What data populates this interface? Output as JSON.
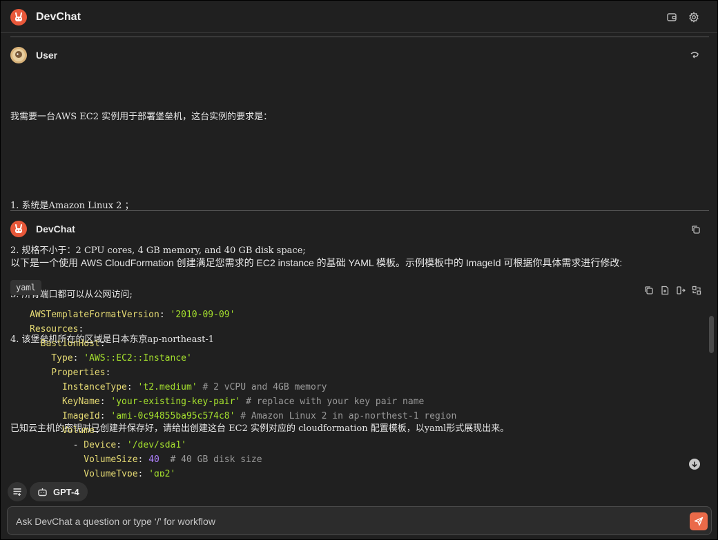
{
  "app": {
    "title": "DevChat"
  },
  "colors": {
    "accent": "#e8583a",
    "send": "#ea6a49",
    "background": "#202020"
  },
  "header": {
    "icons": [
      "wallet-icon",
      "gear-icon"
    ]
  },
  "user_message": {
    "sender": "User",
    "lines": [
      "我需要一台AWS EC2 实例用于部署堡垒机，这台实例的要求是：",
      "",
      "1. 系统是Amazon Linux 2 ；",
      "2. 规格不小于：2 CPU cores, 4 GB memory, and 40 GB disk space;",
      "3. 所有端口都可以从公网访问;",
      "4. 该堡垒机所在的区域是日本东京ap-northeast-1",
      "",
      "已知云主机的密钥对已创建并保存好，请给出创建这台 EC2 实例对应的 cloudformation 配置模板，以yaml形式展现出来。"
    ]
  },
  "bot_message": {
    "sender": "DevChat",
    "intro": "以下是一个使用 AWS CloudFormation 创建满足您需求的 EC2 instance 的基础 YAML 模板。示例模板中的 ImageId 可根据你具体需求进行修改:",
    "code_language": "yaml",
    "code_lines": [
      [
        {
          "t": "AWSTemplateFormatVersion",
          "c": "k"
        },
        {
          "t": ": ",
          "c": "p"
        },
        {
          "t": "'2010-09-09'",
          "c": "s"
        }
      ],
      [
        {
          "t": "Resources",
          "c": "k"
        },
        {
          "t": ":",
          "c": "p"
        }
      ],
      [
        {
          "t": "  BastionHost",
          "c": "k"
        },
        {
          "t": ":",
          "c": "p"
        }
      ],
      [
        {
          "t": "    Type",
          "c": "k"
        },
        {
          "t": ": ",
          "c": "p"
        },
        {
          "t": "'AWS::EC2::Instance'",
          "c": "s"
        }
      ],
      [
        {
          "t": "    Properties",
          "c": "k"
        },
        {
          "t": ":",
          "c": "p"
        }
      ],
      [
        {
          "t": "      InstanceType",
          "c": "k"
        },
        {
          "t": ": ",
          "c": "p"
        },
        {
          "t": "'t2.medium'",
          "c": "s"
        },
        {
          "t": " # 2 vCPU and 4GB memory",
          "c": "c"
        }
      ],
      [
        {
          "t": "      KeyName",
          "c": "k"
        },
        {
          "t": ": ",
          "c": "p"
        },
        {
          "t": "'your-existing-key-pair'",
          "c": "s"
        },
        {
          "t": " # replace with your key pair name",
          "c": "c"
        }
      ],
      [
        {
          "t": "      ImageId",
          "c": "k"
        },
        {
          "t": ": ",
          "c": "p"
        },
        {
          "t": "'ami-0c94855ba95c574c8'",
          "c": "s"
        },
        {
          "t": " # Amazon Linux 2 in ap-northest-1 region",
          "c": "c"
        }
      ],
      [
        {
          "t": "      Volume",
          "c": "k"
        },
        {
          "t": ":",
          "c": "p"
        }
      ],
      [
        {
          "t": "        - ",
          "c": "p"
        },
        {
          "t": "Device",
          "c": "k"
        },
        {
          "t": ": ",
          "c": "p"
        },
        {
          "t": "'/dev/sda1'",
          "c": "s"
        }
      ],
      [
        {
          "t": "          VolumeSize",
          "c": "k"
        },
        {
          "t": ": ",
          "c": "p"
        },
        {
          "t": "40",
          "c": "n"
        },
        {
          "t": "  # 40 GB disk size",
          "c": "c"
        }
      ],
      [
        {
          "t": "          VolumeType",
          "c": "k"
        },
        {
          "t": ": ",
          "c": "p"
        },
        {
          "t": "'gp2'",
          "c": "s"
        }
      ]
    ]
  },
  "toolbar": {
    "model_label": "GPT-4"
  },
  "input": {
    "placeholder": "Ask DevChat a question or type ‘/’ for workflow",
    "value": ""
  }
}
